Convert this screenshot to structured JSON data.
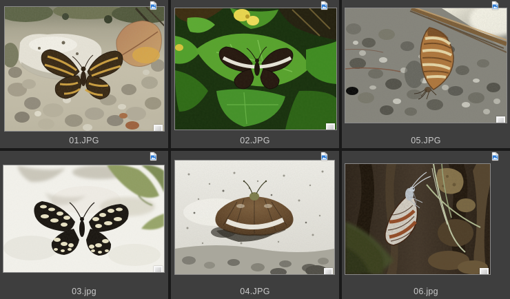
{
  "window": {
    "view": "image-thumbnail-grid",
    "columns": 3,
    "rows": 2
  },
  "colors": {
    "page_background": "#191919",
    "tile_background": "#3e3e3e",
    "filename_text": "#c9c9c9",
    "file_icon_accent": "#2e7cd6",
    "corner_badge": "#d6d6d6"
  },
  "icons": {
    "overlay": "image-file-icon",
    "corner": "thumbnail-corner-badge"
  },
  "files": [
    {
      "name": "01.JPG",
      "thumbnail": "butterfly with orange-striped brown wings on pebble ground with white stone and dry leaf"
    },
    {
      "name": "02.JPG",
      "thumbnail": "dark brown butterfly with white band resting on bright green leaves with yellow flower"
    },
    {
      "name": "05.JPG",
      "thumbnail": "butterfly with closed orange and cream wings on dark gravel beside a diagonal stick"
    },
    {
      "name": "03.jpg",
      "thumbnail": "black butterfly with cream spot bands on white textured wall under green leaves"
    },
    {
      "name": "04.JPG",
      "thumbnail": "brown butterfly with white band perched on light concrete casting a shadow"
    },
    {
      "name": "06.jpg",
      "thumbnail": "butterfly with white and rust striped underwings hanging on dark tree bark with grass blades"
    }
  ]
}
